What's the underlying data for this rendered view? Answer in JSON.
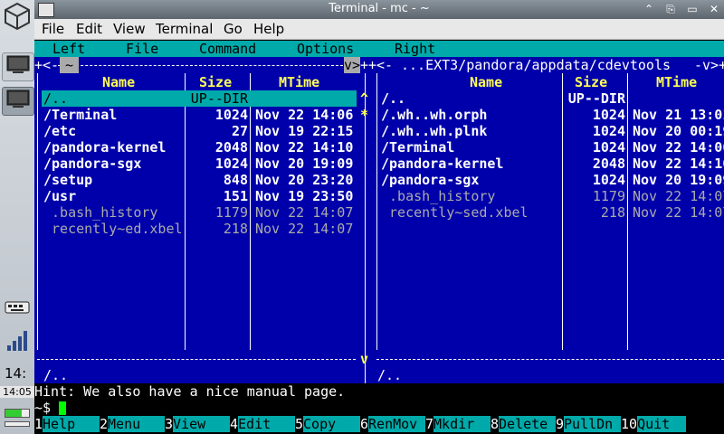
{
  "window": {
    "title": "Terminal - mc - ~",
    "buttons": [
      "⌃",
      "⎘",
      "▭",
      "✕"
    ]
  },
  "menubar": [
    "File",
    "Edit",
    "View",
    "Terminal",
    "Go",
    "Help"
  ],
  "mc_menu": [
    "Left",
    "File",
    "Command",
    "Options",
    "Right"
  ],
  "left_panel": {
    "path": "~",
    "path_border": "+<- ~ ------------------------------------------v>+",
    "headers": {
      "name": "Name",
      "size": "Size",
      "mtime": "MTime"
    },
    "files": [
      {
        "name": "/..",
        "size": "UP--DIR",
        "mtime": "",
        "style": "selected"
      },
      {
        "name": "/Terminal",
        "size": "1024",
        "mtime": "Nov 22 14:06",
        "style": "bold"
      },
      {
        "name": "/etc",
        "size": "27",
        "mtime": "Nov 19 22:15",
        "style": "bold"
      },
      {
        "name": "/pandora-kernel",
        "size": "2048",
        "mtime": "Nov 22 14:10",
        "style": "bold"
      },
      {
        "name": "/pandora-sgx",
        "size": "1024",
        "mtime": "Nov 20 19:09",
        "style": "bold"
      },
      {
        "name": "/setup",
        "size": "848",
        "mtime": "Nov 20 23:20",
        "style": "bold"
      },
      {
        "name": "/usr",
        "size": "151",
        "mtime": "Nov 19 23:50",
        "style": "bold"
      },
      {
        "name": " .bash_history",
        "size": "1179",
        "mtime": "Nov 22 14:07",
        "style": "dim"
      },
      {
        "name": " recently~ed.xbel",
        "size": "218",
        "mtime": "Nov 22 14:07",
        "style": "dim"
      }
    ],
    "status": "/..",
    "scroll_up": "^",
    "scroll_star": "*",
    "scroll_down": "v"
  },
  "right_panel": {
    "path": "...EXT3/pandora/appdata/cdevtools",
    "headers": {
      "name": "Name",
      "size": "Size",
      "mtime": "MTime"
    },
    "files": [
      {
        "name": "/..",
        "size": "UP--DIR",
        "mtime": "",
        "style": "bold"
      },
      {
        "name": "/.wh..wh.orph",
        "size": "1024",
        "mtime": "Nov 21 13:01",
        "style": "bold"
      },
      {
        "name": "/.wh..wh.plnk",
        "size": "1024",
        "mtime": "Nov 20 00:19",
        "style": "bold"
      },
      {
        "name": "/Terminal",
        "size": "1024",
        "mtime": "Nov 22 14:06",
        "style": "bold"
      },
      {
        "name": "/pandora-kernel",
        "size": "2048",
        "mtime": "Nov 22 14:10",
        "style": "bold"
      },
      {
        "name": "/pandora-sgx",
        "size": "1024",
        "mtime": "Nov 20 19:09",
        "style": "bold"
      },
      {
        "name": " .bash_history",
        "size": "1179",
        "mtime": "Nov 22 14:07",
        "style": "dim"
      },
      {
        "name": " recently~sed.xbel",
        "size": "218",
        "mtime": "Nov 22 14:07",
        "style": "dim"
      }
    ],
    "status": "/..",
    "scroll_up": "^",
    "scroll_star": "*",
    "scroll_down": "v"
  },
  "hint": "Hint: We also have a nice manual page.",
  "prompt": "~$ ",
  "fkeys": [
    {
      "num": "1",
      "label": "Help"
    },
    {
      "num": "2",
      "label": "Menu"
    },
    {
      "num": "3",
      "label": "View"
    },
    {
      "num": "4",
      "label": "Edit"
    },
    {
      "num": "5",
      "label": "Copy"
    },
    {
      "num": "6",
      "label": "RenMov"
    },
    {
      "num": "7",
      "label": "Mkdir"
    },
    {
      "num": "8",
      "label": "Delete"
    },
    {
      "num": "9",
      "label": "PullDn"
    },
    {
      "num": "10",
      "label": "Quit"
    }
  ],
  "dock": {
    "clock_short": "14:",
    "clock_full": "14:05",
    "battery_level": 0.7
  },
  "colors": {
    "panel_bg": "#0000aa",
    "cyan": "#00aaaa",
    "header_yellow": "#ffff55",
    "cursor_green": "#00ff00"
  }
}
